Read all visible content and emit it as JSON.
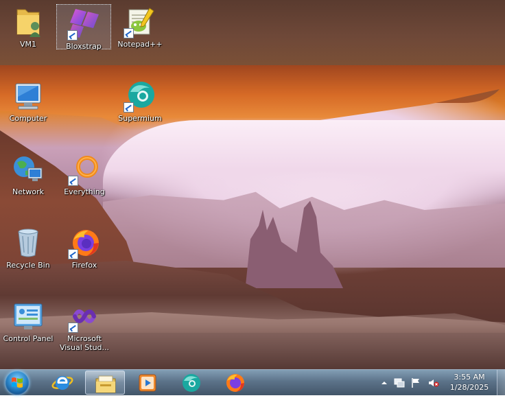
{
  "desktop": {
    "wallpaper": "canyon-arch-wallpaper",
    "icons": [
      {
        "label": "VM1",
        "icon": "folder-user-icon",
        "shortcut": false
      },
      {
        "label": "Bloxstrap",
        "icon": "bloxstrap-icon",
        "shortcut": true,
        "selected": true
      },
      {
        "label": "Notepad++",
        "icon": "notepad-plus-plus-icon",
        "shortcut": true
      },
      {
        "label": "Computer",
        "icon": "computer-icon",
        "shortcut": false
      },
      {
        "label": "Supermium",
        "icon": "supermium-icon",
        "shortcut": true
      },
      {
        "label": "Network",
        "icon": "network-icon",
        "shortcut": false
      },
      {
        "label": "Everything",
        "icon": "everything-search-icon",
        "shortcut": true
      },
      {
        "label": "Recycle Bin",
        "icon": "recycle-bin-icon",
        "shortcut": false
      },
      {
        "label": "Firefox",
        "icon": "firefox-icon",
        "shortcut": true
      },
      {
        "label": "Control Panel",
        "icon": "control-panel-icon",
        "shortcut": false
      },
      {
        "label": "Microsoft Visual Stud...",
        "icon": "visual-studio-icon",
        "shortcut": true
      }
    ]
  },
  "taskbar": {
    "start_button": "windows-start-orb-icon",
    "pinned": [
      {
        "name": "internet-explorer",
        "icon": "internet-explorer-icon",
        "active": false
      },
      {
        "name": "windows-explorer",
        "icon": "folder-library-icon",
        "active": true
      },
      {
        "name": "media-player",
        "icon": "media-player-icon",
        "active": false
      },
      {
        "name": "supermium",
        "icon": "supermium-icon",
        "active": false
      },
      {
        "name": "firefox",
        "icon": "firefox-icon",
        "active": false
      }
    ],
    "tray": {
      "icons": [
        "show-hidden-icons-arrow",
        "network-status-icon",
        "action-center-flag-icon",
        "volume-muted-icon"
      ],
      "time": "3:55 AM",
      "date": "1/28/2025"
    }
  },
  "colors": {
    "taskbar": "#4e6a86",
    "label_text": "#ffffff",
    "sky": "#f0d8ea",
    "arch_glow": "#e0822e"
  }
}
